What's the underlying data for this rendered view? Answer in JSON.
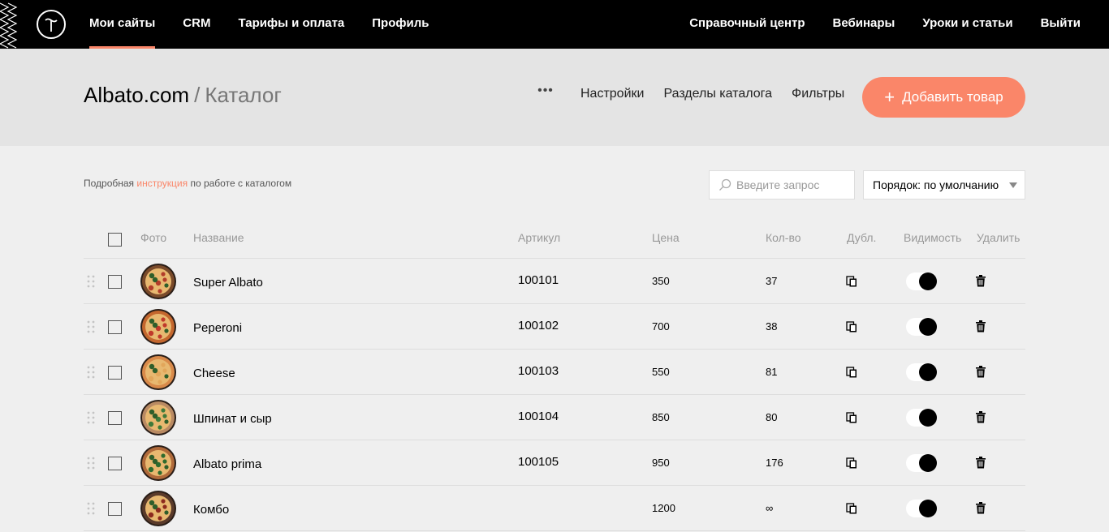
{
  "nav": {
    "left": [
      {
        "label": "Мои сайты",
        "active": true
      },
      {
        "label": "CRM",
        "active": false
      },
      {
        "label": "Тарифы и оплата",
        "active": false
      },
      {
        "label": "Профиль",
        "active": false
      }
    ],
    "right": [
      {
        "label": "Справочный центр"
      },
      {
        "label": "Вебинары"
      },
      {
        "label": "Уроки и статьи"
      },
      {
        "label": "Выйти"
      }
    ]
  },
  "header": {
    "site": "Albato.com",
    "separator": "/",
    "page": "Каталог",
    "more_icon": "ellipsis-icon",
    "menu": [
      "Настройки",
      "Разделы каталога",
      "Фильтры"
    ],
    "add_button": {
      "plus": "+",
      "label": "Добавить товар"
    }
  },
  "toolbar": {
    "hint_before": "Подробная",
    "hint_link": "инструкция",
    "hint_after": "по работе с каталогом",
    "search_placeholder": "Введите запрос",
    "sort_label": "Порядок: по умолчанию"
  },
  "table": {
    "columns": {
      "photo": "Фото",
      "name": "Название",
      "sku": "Артикул",
      "price": "Цена",
      "qty": "Кол-во",
      "dup": "Дубл.",
      "visibility": "Видимость",
      "delete": "Удалить"
    },
    "rows": [
      {
        "name": "Super Albato",
        "sku": "100101",
        "price": "350",
        "qty": "37",
        "visible": true
      },
      {
        "name": "Peperoni",
        "sku": "100102",
        "price": "700",
        "qty": "38",
        "visible": true
      },
      {
        "name": "Cheese",
        "sku": "100103",
        "price": "550",
        "qty": "81",
        "visible": true
      },
      {
        "name": "Шпинат и сыр",
        "sku": "100104",
        "price": "850",
        "qty": "80",
        "visible": true
      },
      {
        "name": "Albato prima",
        "sku": "100105",
        "price": "950",
        "qty": "176",
        "visible": true
      },
      {
        "name": "Комбо",
        "sku": "",
        "price": "1200",
        "qty": "∞",
        "visible": true
      }
    ]
  },
  "colors": {
    "accent": "#fa8669",
    "nav_bg": "#000000",
    "header_bg": "#e4e4e4",
    "page_bg": "#efefef"
  }
}
